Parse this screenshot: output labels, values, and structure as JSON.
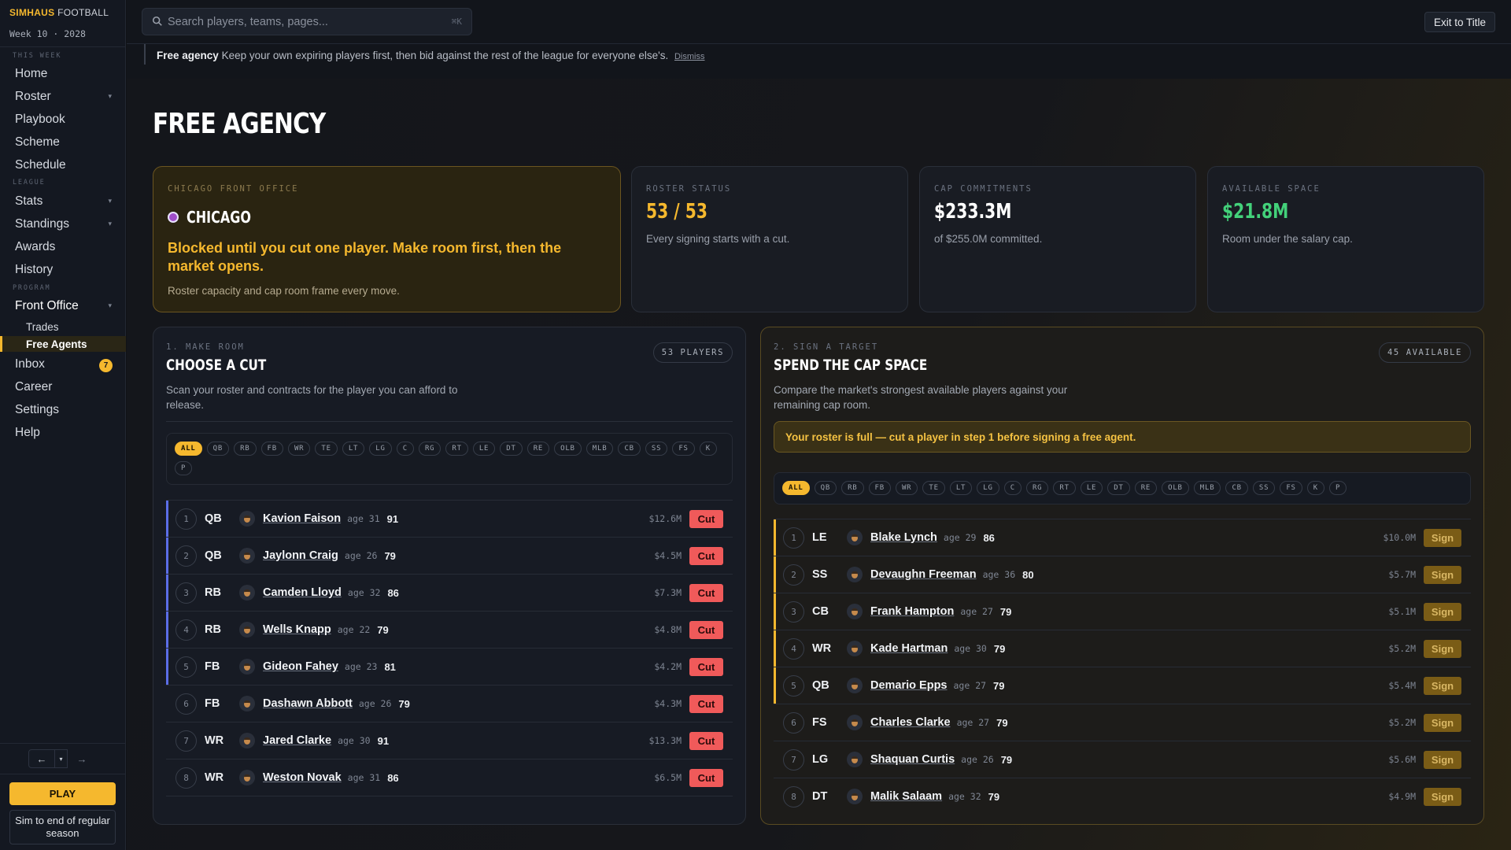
{
  "brand": {
    "part1": "SIMHAUS",
    "part2": "FOOTBALL"
  },
  "week_label": "Week 10 · 2028",
  "sidebar": {
    "sections": [
      "THIS WEEK",
      "LEAGUE",
      "PROGRAM"
    ],
    "items": [
      {
        "label": "Home"
      },
      {
        "label": "Roster"
      },
      {
        "label": "Playbook"
      },
      {
        "label": "Scheme"
      },
      {
        "label": "Schedule"
      },
      {
        "label": "Stats"
      },
      {
        "label": "Standings"
      },
      {
        "label": "Awards"
      },
      {
        "label": "History"
      },
      {
        "label": "Front Office"
      },
      {
        "label": "Trades"
      },
      {
        "label": "Free Agents"
      },
      {
        "label": "Inbox",
        "badge": "7"
      },
      {
        "label": "Career"
      },
      {
        "label": "Settings"
      },
      {
        "label": "Help"
      }
    ],
    "play_label": "PLAY",
    "sim_label": "Sim to end of regular season"
  },
  "search": {
    "placeholder": "Search players, teams, pages...",
    "shortcut": "⌘K"
  },
  "exit_label": "Exit to Title",
  "notice": {
    "title": "Free agency",
    "text": "Keep your own expiring players first, then bid against the rest of the league for everyone else's.",
    "dismiss": "Dismiss"
  },
  "page_title": "FREE AGENCY",
  "office": {
    "label": "CHICAGO FRONT OFFICE",
    "team": "CHICAGO",
    "team_color": "#a04ec9",
    "blocked": "Blocked until you cut one player. Make room first, then the market opens.",
    "frame": "Roster capacity and cap room frame every move."
  },
  "stats": [
    {
      "label": "ROSTER STATUS",
      "value": "53 / 53",
      "desc": "Every signing starts with a cut.",
      "color": "#f5b82e"
    },
    {
      "label": "CAP COMMITMENTS",
      "value": "$233.3M",
      "desc": "of $255.0M committed.",
      "color": "#ffffff"
    },
    {
      "label": "AVAILABLE SPACE",
      "value": "$21.8M",
      "desc": "Room under the salary cap.",
      "color": "#43d17a"
    }
  ],
  "cut_panel": {
    "step": "1. MAKE ROOM",
    "title": "CHOOSE A CUT",
    "desc": "Scan your roster and contracts for the player you can afford to release.",
    "count": "53 PLAYERS",
    "filters": [
      "ALL",
      "QB",
      "RB",
      "FB",
      "WR",
      "TE",
      "LT",
      "LG",
      "C",
      "RG",
      "RT",
      "LE",
      "DT",
      "RE",
      "OLB",
      "MLB",
      "CB",
      "SS",
      "FS",
      "K",
      "P"
    ],
    "action_label": "Cut",
    "rows": [
      {
        "rank": "1",
        "pos": "QB",
        "name": "Kavion Faison",
        "age": "age 31",
        "ovr": "91",
        "salary": "$12.6M"
      },
      {
        "rank": "2",
        "pos": "QB",
        "name": "Jaylonn Craig",
        "age": "age 26",
        "ovr": "79",
        "salary": "$4.5M"
      },
      {
        "rank": "3",
        "pos": "RB",
        "name": "Camden Lloyd",
        "age": "age 32",
        "ovr": "86",
        "salary": "$7.3M"
      },
      {
        "rank": "4",
        "pos": "RB",
        "name": "Wells Knapp",
        "age": "age 22",
        "ovr": "79",
        "salary": "$4.8M"
      },
      {
        "rank": "5",
        "pos": "FB",
        "name": "Gideon Fahey",
        "age": "age 23",
        "ovr": "81",
        "salary": "$4.2M"
      },
      {
        "rank": "6",
        "pos": "FB",
        "name": "Dashawn Abbott",
        "age": "age 26",
        "ovr": "79",
        "salary": "$4.3M"
      },
      {
        "rank": "7",
        "pos": "WR",
        "name": "Jared Clarke",
        "age": "age 30",
        "ovr": "91",
        "salary": "$13.3M"
      },
      {
        "rank": "8",
        "pos": "WR",
        "name": "Weston Novak",
        "age": "age 31",
        "ovr": "86",
        "salary": "$6.5M"
      }
    ]
  },
  "sign_panel": {
    "step": "2. SIGN A TARGET",
    "title": "SPEND THE CAP SPACE",
    "desc": "Compare the market's strongest available players against your remaining cap room.",
    "count": "45 AVAILABLE",
    "warning": "Your roster is full — cut a player in step 1 before signing a free agent.",
    "filters": [
      "ALL",
      "QB",
      "RB",
      "FB",
      "WR",
      "TE",
      "LT",
      "LG",
      "C",
      "RG",
      "RT",
      "LE",
      "DT",
      "RE",
      "OLB",
      "MLB",
      "CB",
      "SS",
      "FS",
      "K",
      "P"
    ],
    "action_label": "Sign",
    "rows": [
      {
        "rank": "1",
        "pos": "LE",
        "name": "Blake Lynch",
        "age": "age 29",
        "ovr": "86",
        "salary": "$10.0M"
      },
      {
        "rank": "2",
        "pos": "SS",
        "name": "Devaughn Freeman",
        "age": "age 36",
        "ovr": "80",
        "salary": "$5.7M"
      },
      {
        "rank": "3",
        "pos": "CB",
        "name": "Frank Hampton",
        "age": "age 27",
        "ovr": "79",
        "salary": "$5.1M"
      },
      {
        "rank": "4",
        "pos": "WR",
        "name": "Kade Hartman",
        "age": "age 30",
        "ovr": "79",
        "salary": "$5.2M"
      },
      {
        "rank": "5",
        "pos": "QB",
        "name": "Demario Epps",
        "age": "age 27",
        "ovr": "79",
        "salary": "$5.4M"
      },
      {
        "rank": "6",
        "pos": "FS",
        "name": "Charles Clarke",
        "age": "age 27",
        "ovr": "79",
        "salary": "$5.2M"
      },
      {
        "rank": "7",
        "pos": "LG",
        "name": "Shaquan Curtis",
        "age": "age 26",
        "ovr": "79",
        "salary": "$5.6M"
      },
      {
        "rank": "8",
        "pos": "DT",
        "name": "Malik Salaam",
        "age": "age 32",
        "ovr": "79",
        "salary": "$4.9M"
      }
    ]
  }
}
